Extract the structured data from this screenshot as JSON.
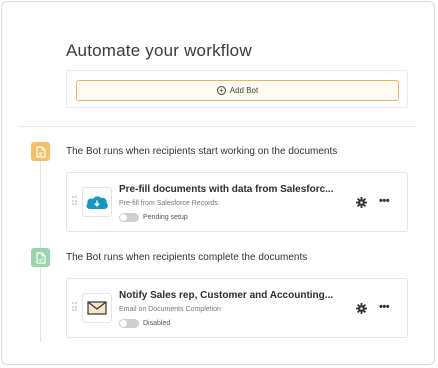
{
  "header": {
    "title": "Automate your workflow"
  },
  "add_bot": {
    "label": "Add Bot"
  },
  "stages": [
    {
      "text": "The Bot runs when recipients start working on the documents",
      "bot": {
        "title": "Pre-fill documents with data from Salesforc...",
        "subtitle": "Pre-fill from Salesforce Records",
        "status": "Pending setup",
        "logo": "salesforce-logo"
      }
    },
    {
      "text": "The Bot runs when recipients complete the documents",
      "bot": {
        "title": "Notify Sales rep, Customer and Accounting...",
        "subtitle": "Email on Documents Completion",
        "status": "Disabled",
        "logo": "envelope-icon"
      }
    }
  ],
  "colors": {
    "accent_orange": "#f6c16a",
    "accent_green": "#9bd3ab",
    "salesforce_blue": "#1798c1"
  }
}
